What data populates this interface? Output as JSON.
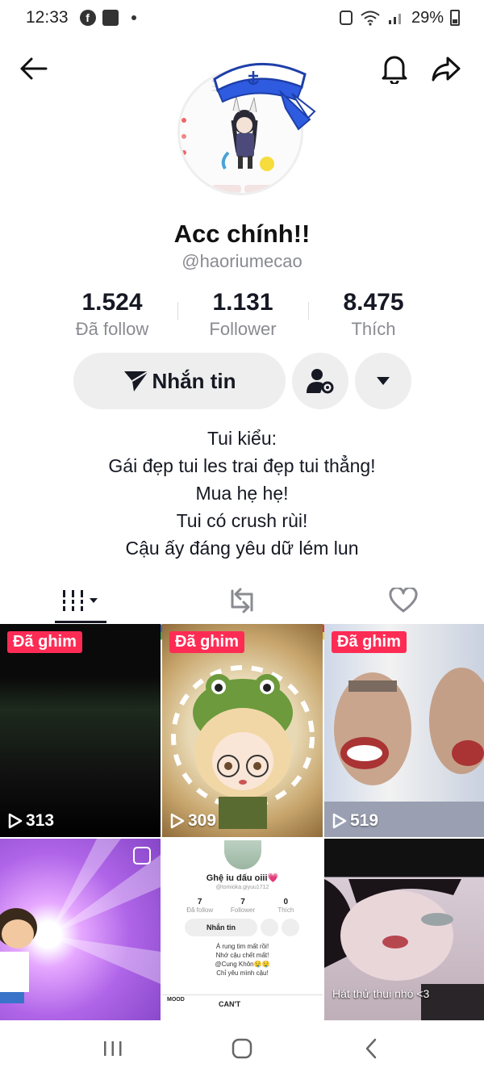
{
  "status_bar": {
    "time": "12:33",
    "battery": "29%",
    "app_icons": [
      "grid-app-icon",
      "facebook-icon",
      "image-icon"
    ]
  },
  "header": {
    "back_icon": "arrow-left-icon",
    "bell_icon": "bell-icon",
    "share_icon": "share-arrow-icon"
  },
  "profile": {
    "display_name": "Acc chính!!",
    "username": "@haoriumecao",
    "stats": [
      {
        "value": "1.524",
        "label": "Đã follow"
      },
      {
        "value": "1.131",
        "label": "Follower"
      },
      {
        "value": "8.475",
        "label": "Thích"
      }
    ],
    "message_button": "Nhắn tin",
    "bio_lines": [
      "Tui kiểu:",
      "Gái đẹp tui les trai đẹp tui thẳng!",
      "Mua hẹ hẹ!",
      "Tui có crush rùi!",
      "Cậu ấy đáng yêu dữ lém lun"
    ]
  },
  "tabs": [
    {
      "icon": "video-grid-icon",
      "active": true
    },
    {
      "icon": "repost-icon",
      "active": false
    },
    {
      "icon": "heart-icon",
      "active": false
    }
  ],
  "videos": [
    {
      "pinned_label": "Đã ghim",
      "views": "313"
    },
    {
      "pinned_label": "Đã ghim",
      "views": "309"
    },
    {
      "pinned_label": "Đã ghim",
      "views": "519"
    },
    {
      "pinned_label": "",
      "views": ""
    },
    {
      "pinned_label": "",
      "views": "",
      "mini_name": "Ghệ iu dấu oiii💗",
      "mini_handle": "@tomioka.giyuu1712",
      "mini_stats": [
        {
          "value": "7",
          "label": "Đã follow"
        },
        {
          "value": "7",
          "label": "Follower"
        },
        {
          "value": "0",
          "label": "Thích"
        }
      ],
      "mini_button": "Nhắn tin",
      "mini_bio": [
        "Á rung tim mất rồi!",
        "Nhớ cậu chết mất!",
        "@Cung Khôn🤤🤤",
        "Chỉ yêu mình cậu!"
      ],
      "mini_mood": "MOOD",
      "mini_cant": "CAN'T"
    },
    {
      "pinned_label": "",
      "views": "",
      "caption": "Hát thử thui nhó <3"
    }
  ],
  "colors": {
    "accent": "#fe2c55",
    "text": "#161823",
    "muted": "#8a8b91"
  }
}
